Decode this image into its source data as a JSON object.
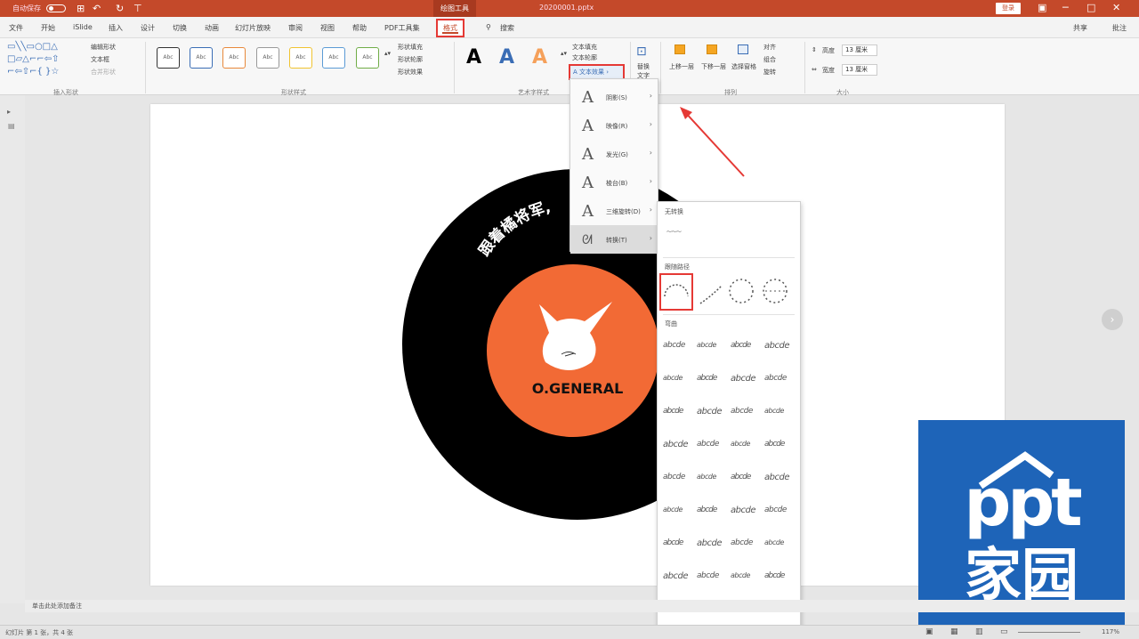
{
  "titlebar": {
    "autosave_label": "自动保存",
    "autosave_state": "关",
    "context_tools": "绘图工具",
    "filename": "20200001.pptx",
    "login": "登录",
    "quick_icons": [
      "save-icon",
      "undo-icon",
      "redo-icon",
      "customize-icon"
    ]
  },
  "menubar": {
    "tabs": [
      "文件",
      "开始",
      "iSlide",
      "插入",
      "设计",
      "切换",
      "动画",
      "幻灯片放映",
      "审阅",
      "视图",
      "帮助",
      "PDF工具集"
    ],
    "active_tab": "格式",
    "search": "搜索",
    "share": "共享",
    "comment": "批注"
  },
  "ribbon": {
    "groups": {
      "insert_shapes": "插入形状",
      "shape_styles": "形状样式",
      "wordart_styles": "艺术字样式",
      "arrange": "排列",
      "size": "大小"
    },
    "shape_tools": [
      "编辑形状",
      "文本框",
      "合并形状"
    ],
    "style_box_label": "Abc",
    "fill_options": [
      "形状填充",
      "形状轮廓",
      "形状效果"
    ],
    "wordart_options": [
      "文本填充",
      "文本轮廓",
      "文本效果"
    ],
    "alt_text": [
      "替换",
      "文字"
    ],
    "arrange_big": [
      "上移一层",
      "下移一层",
      "选择窗格"
    ],
    "arrange_small": [
      "对齐",
      "组合",
      "旋转"
    ],
    "size": {
      "height_label": "高度",
      "height_value": "13 厘米",
      "width_label": "宽度",
      "width_value": "13 厘米"
    }
  },
  "effects_menu": {
    "button": "文本效果",
    "items": [
      "阴影(S)",
      "映像(R)",
      "发光(G)",
      "棱台(B)",
      "三维旋转(D)",
      "转换(T)"
    ],
    "selected_index": 5
  },
  "transform_panel": {
    "no_transform_header": "无转换",
    "follow_path_header": "跟随路径",
    "warp_header": "弯曲",
    "warp_sample": "abcde",
    "warp_rows": 9
  },
  "slide": {
    "arc_text": "跟着橘将军,",
    "brand": "O.GENERAL",
    "colors": {
      "disc": "#000000",
      "label": "#f26a35",
      "cat": "#ffffff"
    }
  },
  "notes": {
    "placeholder": "单击此处添加备注"
  },
  "statusbar": {
    "slide_info": "幻灯片 第 1 张，共 4 张",
    "zoom": "117%"
  },
  "watermark": {
    "line1": "ppt",
    "line2": "家园",
    "color": "#1e64b8"
  }
}
